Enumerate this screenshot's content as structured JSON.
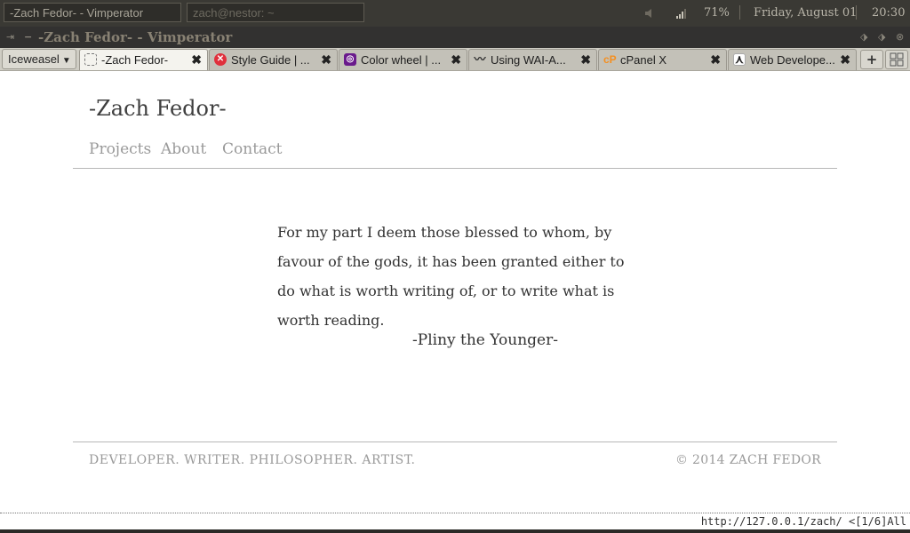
{
  "panel": {
    "task_vimperator": "-Zach Fedor- - Vimperator",
    "task_terminal": "zach@nestor: ~",
    "battery": "71%",
    "date": "Friday, August 01",
    "time": "20:30"
  },
  "window": {
    "title": "-Zach Fedor- - Vimperator"
  },
  "tabs": {
    "app_menu": "Iceweasel",
    "items": [
      {
        "label": "-Zach Fedor-",
        "icon": "blank-page-icon"
      },
      {
        "label": "Style Guide | ...",
        "icon": "styleguide-icon"
      },
      {
        "label": "Color wheel | ...",
        "icon": "color-wheel-icon"
      },
      {
        "label": "Using WAI-A...",
        "icon": "w3c-icon"
      },
      {
        "label": "cPanel X",
        "icon": "cpanel-icon"
      },
      {
        "label": "Web Develope...",
        "icon": "mdn-icon"
      }
    ],
    "new_tab": "+"
  },
  "page": {
    "site_title": "-Zach Fedor-",
    "nav": [
      "Projects",
      "About",
      "Contact"
    ],
    "quote": "For my part I deem those blessed to whom, by favour of the gods, it has been granted either to do what is worth writing of, or to write what is worth reading.",
    "quote_author": "-Pliny the Younger-",
    "footer_tagline": "DEVELOPER. WRITER. PHILOSOPHER. ARTIST.",
    "footer_copy": "© 2014 ZACH FEDOR"
  },
  "status": {
    "text": "http://127.0.0.1/zach/ <[1/6]All"
  },
  "colors": {
    "accent_cpanel": "#f48f20",
    "accent_styleguide": "#e0303c",
    "accent_colorwheel": "#6a1a8c"
  }
}
